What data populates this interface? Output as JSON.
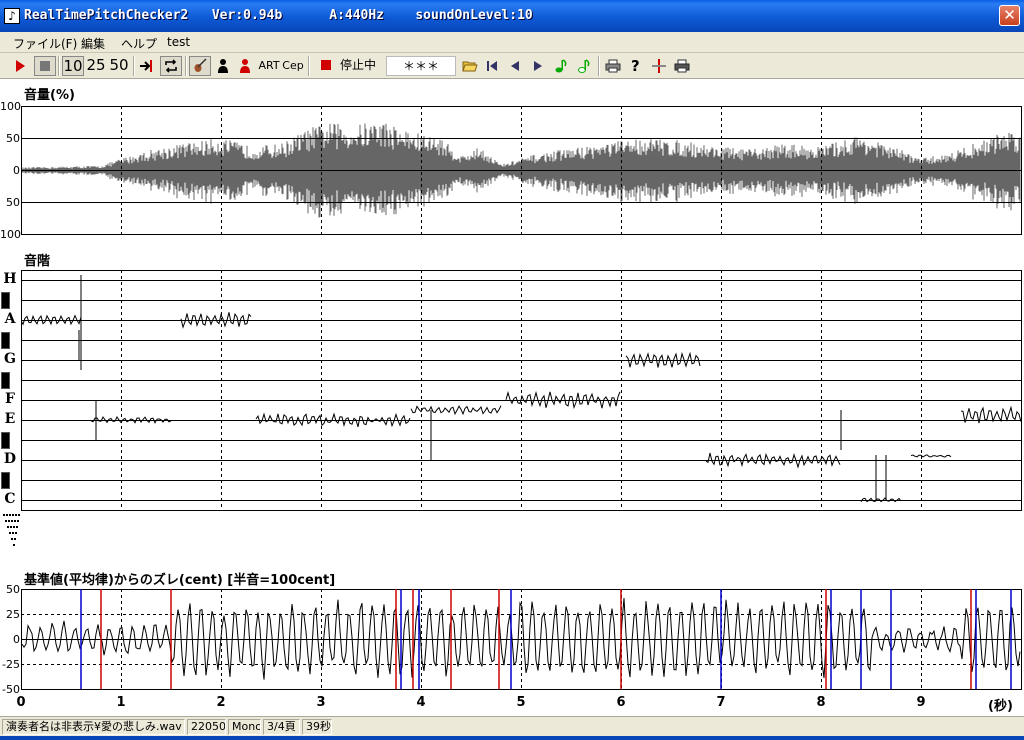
{
  "window": {
    "title": "RealTimePitchChecker2   Ver:0.94b      A:440Hz    soundOnLevel:10",
    "close_label": "✕"
  },
  "menu": [
    "ファイル(F)",
    "編集",
    "ヘルプ",
    "test"
  ],
  "toolbar": {
    "zoom_buttons": [
      "10",
      "25",
      "50"
    ],
    "art_label": "ART",
    "cep_label": "Cep",
    "state_label": "停止中",
    "display_value": "＊＊＊"
  },
  "volume_panel": {
    "label": "音量(%)",
    "y_ticks": [
      "100",
      "50",
      "0",
      "50",
      "100"
    ]
  },
  "scale_panel": {
    "label": "音階",
    "notes": [
      "H",
      "A",
      "G",
      "F",
      "E",
      "D",
      "C"
    ]
  },
  "cent_panel": {
    "label": "基準値(平均律)からのズレ(cent) [半音=100cent]",
    "y_ticks": [
      "50",
      "25",
      "0",
      "-25",
      "-50"
    ]
  },
  "time_axis": {
    "ticks": [
      "0",
      "1",
      "2",
      "3",
      "4",
      "5",
      "6",
      "7",
      "8",
      "9"
    ],
    "unit": "(秒)"
  },
  "colors": {
    "accent_red": "#d00000",
    "marker_blue": "#0000cc",
    "title_blue": "#0a5fe4"
  },
  "statusbar": [
    "演奏者名は非表示¥愛の悲しみ.wav",
    "22050",
    "Mono",
    "3/4頁",
    "39秒"
  ]
}
